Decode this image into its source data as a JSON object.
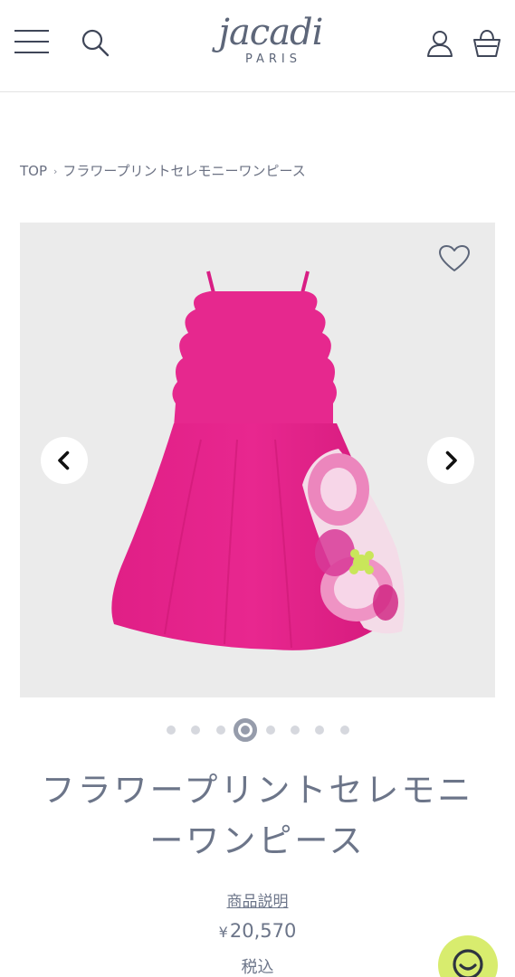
{
  "header": {
    "logo_script": "jacadi",
    "logo_sub": "PARIS",
    "icons": [
      "menu-icon",
      "search-icon",
      "account-icon",
      "cart-icon"
    ]
  },
  "breadcrumb": {
    "items": [
      "TOP",
      "フラワープリントセレモニーワンピース"
    ],
    "separator": "›"
  },
  "gallery": {
    "total_images": 8,
    "active_index": 3,
    "background": "#ebebeb",
    "dress_color": "#e3248a",
    "icons": [
      "heart-icon",
      "chevron-left-icon",
      "chevron-right-icon"
    ]
  },
  "product": {
    "title_line1": "フラワープリントセレモニ",
    "title_line2": "ーワンピース",
    "description_link": "商品説明",
    "currency": "¥",
    "price": "20,570",
    "tax_label": "税込"
  },
  "colors": {
    "text": "#6c7589",
    "accent_chat": "#d8ec6e"
  }
}
